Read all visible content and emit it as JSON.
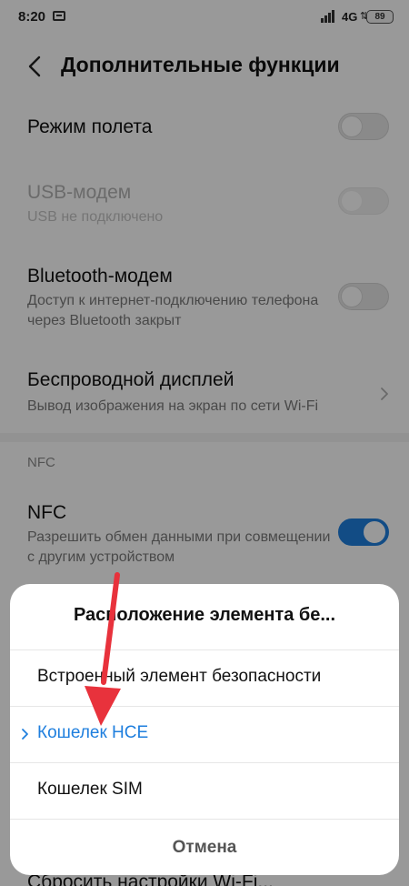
{
  "status_bar": {
    "time": "8:20",
    "network": "4G",
    "battery": "89",
    "icons": [
      "notification-app-icon",
      "signal-icon",
      "data-arrows-icon",
      "battery-icon"
    ]
  },
  "header": {
    "title": "Дополнительные функции",
    "back_icon": "chevron-left-icon"
  },
  "settings": {
    "airplane": {
      "title": "Режим полета",
      "enabled": false
    },
    "usb_modem": {
      "title": "USB-модем",
      "subtitle": "USB не подключено",
      "enabled": false,
      "disabled": true
    },
    "bt_modem": {
      "title": "Bluetooth-модем",
      "subtitle": "Доступ к интернет-подключению телефона через Bluetooth закрыт",
      "enabled": false
    },
    "wireless_display": {
      "title": "Беспроводной дисплей",
      "subtitle": "Вывод изображения на экран по сети Wi-Fi"
    },
    "nfc_section": "NFC",
    "nfc": {
      "title": "NFC",
      "subtitle": "Разрешить обмен данными при совмещении с другим устройством",
      "enabled": true
    },
    "partial_bottom": "Сбросить настройки Wi-Fi..."
  },
  "dialog": {
    "title": "Расположение элемента бе...",
    "options": [
      {
        "label": "Встроенный элемент безопасности",
        "selected": false
      },
      {
        "label": "Кошелек HCE",
        "selected": true
      },
      {
        "label": "Кошелек SIM",
        "selected": false
      }
    ],
    "cancel": "Отмена"
  },
  "colors": {
    "accent": "#1f7fde",
    "annotation_arrow": "#e8323c"
  }
}
